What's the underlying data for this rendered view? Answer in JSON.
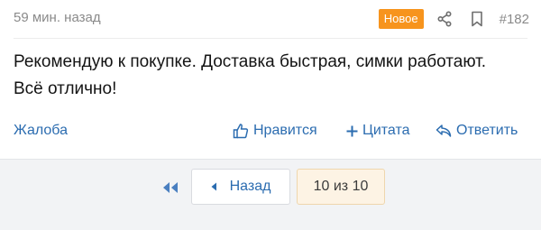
{
  "post": {
    "time": "59 мин. назад",
    "badge": "Новое",
    "share_icon": "share-icon",
    "bookmark_icon": "bookmark-icon",
    "number": "#182",
    "text": "Рекомендую к покупке. Доставка быстрая, симки работают. Всё отлично!",
    "actions": {
      "report": "Жалоба",
      "like": "Нравится",
      "quote": "Цитата",
      "reply": "Ответить"
    }
  },
  "pagination": {
    "first_icon": "double-chevron-left-icon",
    "back_label": "Назад",
    "page_indicator": "10 из 10"
  },
  "colors": {
    "badge": "#f7941d",
    "link": "#2b6cb0",
    "page_indicator_bg": "#fdf3e4"
  }
}
